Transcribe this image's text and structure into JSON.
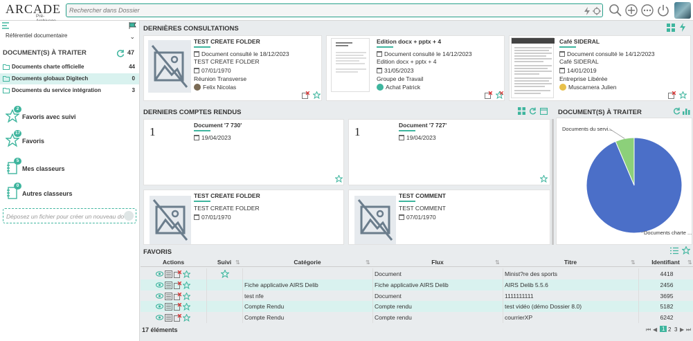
{
  "app": {
    "brand": "ARCADE",
    "subtitle": "Pré-Archivage"
  },
  "search": {
    "placeholder": "Rechercher dans Dossier"
  },
  "colors": {
    "accent": "#3eb59e",
    "selected_row": "#d9f2ef",
    "pie_main": "#4b6fc8",
    "pie_secondary": "#8cd07a"
  },
  "sidebar": {
    "referential": "Référentiel documentaire",
    "docs_header": "DOCUMENT(S) À TRAITER",
    "docs_total": "47",
    "doc_items": [
      {
        "label": "Documents charte officielle",
        "count": "44"
      },
      {
        "label": "Documents globaux Digitech",
        "count": "0"
      },
      {
        "label": "Documents du service intégration",
        "count": "3"
      }
    ],
    "items": [
      {
        "label": "Favoris avec suivi",
        "badge": "2",
        "icon": "star-follow-icon"
      },
      {
        "label": "Favoris",
        "badge": "17",
        "icon": "star-icon"
      },
      {
        "label": "Mes classeurs",
        "badge": "5",
        "icon": "binder-icon"
      },
      {
        "label": "Autres classeurs",
        "badge": "0",
        "icon": "binder-outline-icon"
      }
    ],
    "dropzone": "Déposez un fichier pour créer un nouveau do"
  },
  "consultations": {
    "title": "DERNIÈRES CONSULTATIONS",
    "cards": [
      {
        "title": "TEST CREATE FOLDER",
        "consulted": "Document consulté le 18/12/2023",
        "name": "TEST CREATE FOLDER",
        "date": "07/01/1970",
        "group": "Réunion Transverse",
        "user": "Felix Nicolas"
      },
      {
        "title": "Edition docx + pptx + 4",
        "consulted": "Document consulté le 14/12/2023",
        "name": "Edition docx + pptx + 4",
        "date": "31/05/2023",
        "group": "Groupe de Travail",
        "user": "Achat Patrick"
      },
      {
        "title": "Café SIDERAL",
        "consulted": "Document consulté le 14/12/2023",
        "name": "Café SIDERAL",
        "date": "14/01/2019",
        "group": "Entreprise Libérée",
        "user": "Muscarnera Julien"
      }
    ]
  },
  "reports": {
    "title": "DERNIERS COMPTES RENDUS",
    "cards": [
      {
        "title": "Document '7 730'",
        "date": "19/04/2023",
        "thumb_text": "1"
      },
      {
        "title": "Document '7 727'",
        "date": "19/04/2023",
        "thumb_text": "1"
      },
      {
        "title": "TEST CREATE FOLDER",
        "name": "TEST CREATE FOLDER",
        "date": "07/01/1970"
      },
      {
        "title": "TEST COMMENT",
        "name": "TEST COMMENT",
        "date": "07/01/1970"
      }
    ]
  },
  "chart_panel": {
    "title": "DOCUMENT(S) À TRAITER"
  },
  "chart_data": {
    "type": "pie",
    "labels": [
      "Documents charte ...",
      "Documents du servi..."
    ],
    "values": [
      44,
      3
    ],
    "colors": [
      "#4b6fc8",
      "#8cd07a"
    ]
  },
  "favoris": {
    "title": "FAVORIS",
    "columns": [
      "Actions",
      "Suivi",
      "Catégorie",
      "Flux",
      "Titre",
      "Identifiant"
    ],
    "rows": [
      {
        "suivi": true,
        "categorie": "",
        "flux": "Document",
        "titre": "Minist?re des sports",
        "id": "4418"
      },
      {
        "suivi": false,
        "categorie": "Fiche applicative AIRS Delib",
        "flux": "Fiche applicative AIRS Delib",
        "titre": "AIRS Delib 5.5.6",
        "id": "2456"
      },
      {
        "suivi": false,
        "categorie": "test nfe",
        "flux": "Document",
        "titre": "1111111111",
        "id": "3695"
      },
      {
        "suivi": false,
        "categorie": "Compte Rendu",
        "flux": "Compte rendu",
        "titre": "test vidéo (démo Dossier 8.0)",
        "id": "5182"
      },
      {
        "suivi": false,
        "categorie": "Compte Rendu",
        "flux": "Compte rendu",
        "titre": "courrierXP",
        "id": "6242"
      }
    ],
    "count_label": "17 éléments",
    "pages": [
      "1",
      "2",
      "3"
    ]
  }
}
